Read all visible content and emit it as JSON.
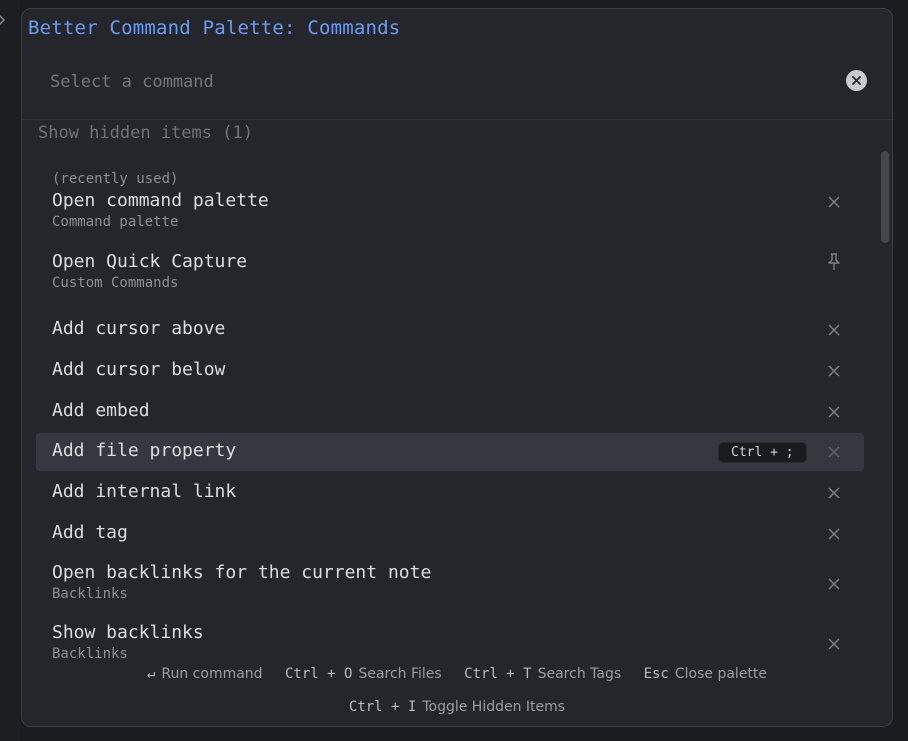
{
  "palette": {
    "title": "Better Command Palette: Commands",
    "search_placeholder": "Select a command",
    "search_value": "",
    "hidden_items_label": "Show hidden items (1)"
  },
  "commands": [
    {
      "pre": "(recently used)",
      "title": "Open command palette",
      "subtitle": "Command palette",
      "action_icon": "close-icon"
    },
    {
      "title": "Open Quick Capture",
      "subtitle": "Custom Commands",
      "action_icon": "pin-icon"
    },
    {
      "title": "Add cursor above",
      "action_icon": "close-icon"
    },
    {
      "title": "Add cursor below",
      "action_icon": "close-icon"
    },
    {
      "title": "Add embed",
      "action_icon": "close-icon"
    },
    {
      "title": "Add file property",
      "hotkey": "Ctrl + ;",
      "action_icon": "close-icon",
      "selected": true
    },
    {
      "title": "Add internal link",
      "action_icon": "close-icon"
    },
    {
      "title": "Add tag",
      "action_icon": "close-icon"
    },
    {
      "title": "Open backlinks for the current note",
      "subtitle": "Backlinks",
      "action_icon": "close-icon"
    },
    {
      "title": "Show backlinks",
      "subtitle": "Backlinks",
      "action_icon": "close-icon"
    }
  ],
  "footer": {
    "row1": [
      {
        "key": "↵",
        "desc": "Run command"
      },
      {
        "key": "Ctrl + O",
        "desc": "Search Files"
      },
      {
        "key": "Ctrl + T",
        "desc": "Search Tags"
      },
      {
        "key": "Esc",
        "desc": "Close palette"
      }
    ],
    "row2": [
      {
        "key": "Ctrl + I",
        "desc": "Toggle Hidden Items"
      }
    ]
  },
  "colors": {
    "accent_title": "#6b9cf5",
    "background": "#25262b",
    "selected_row": "#363840"
  }
}
